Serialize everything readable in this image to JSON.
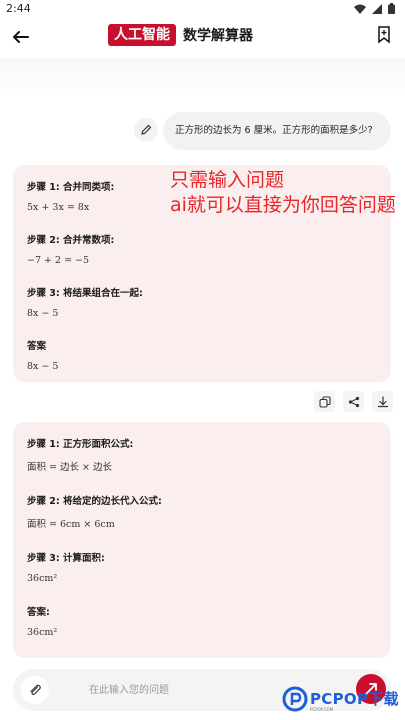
{
  "status_bar": {
    "time": "2:44"
  },
  "header": {
    "brand": "人工智能",
    "title": "数学解算器"
  },
  "conversation": {
    "user_question": "正方形的边长为 6 厘米。正方形的面积是多少?",
    "answer_1": [
      {
        "title": "步骤 1: 合并同类项:",
        "math": "5x + 3x = 8x"
      },
      {
        "title": "步骤 2: 合并常数项:",
        "math": "−7 + 2 = −5"
      },
      {
        "title": "步骤 3: 将结果组合在一起:",
        "math": "8x − 5"
      },
      {
        "title": "答案",
        "math": "8x − 5"
      }
    ],
    "answer_2": [
      {
        "title": "步骤 1: 正方形面积公式:",
        "math": "面积 = 边长 × 边长"
      },
      {
        "title": "步骤 2: 将给定的边长代入公式:",
        "math": "面积 = 6cm × 6cm"
      },
      {
        "title": "步骤 3: 计算面积:",
        "math": "36cm²"
      },
      {
        "title": "答案:",
        "math": "36cm²"
      }
    ]
  },
  "annotation": {
    "line1": "只需输入问题",
    "line2": "ai就可以直接为你回答问题"
  },
  "composer": {
    "placeholder": "在此输入您的问题"
  },
  "watermark": {
    "text": "PCPOP下载",
    "sub": "PCPOP.COM"
  },
  "colors": {
    "brand": "#c8102e",
    "card_bg": "#fbeeee",
    "annotation": "#e8262a"
  }
}
